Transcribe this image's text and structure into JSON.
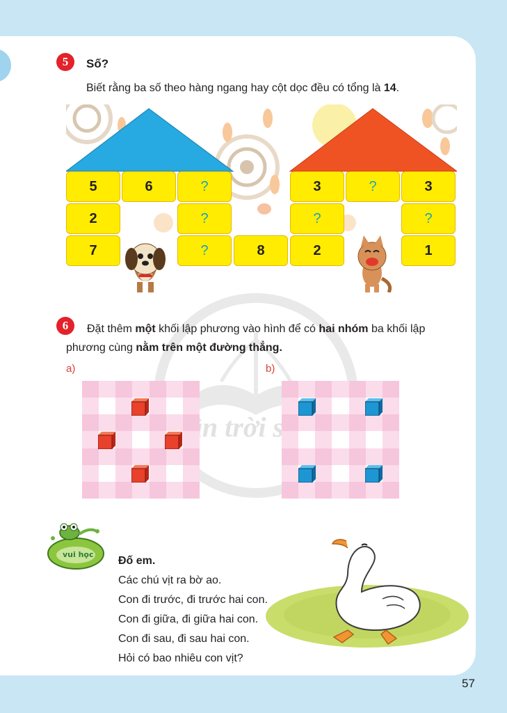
{
  "exercise5": {
    "number": "5",
    "title": "Số?",
    "instruction_prefix": "Biết rằng ba số theo hàng ngang hay cột dọc đều có tổng là ",
    "instruction_bold": "14",
    "instruction_suffix": ".",
    "left_house": {
      "roof_color": "#27a9e1",
      "cells": [
        [
          "5",
          "6",
          "?"
        ],
        [
          "2",
          "",
          "?"
        ],
        [
          "7",
          "",
          "?"
        ]
      ]
    },
    "middle_cell": "8",
    "right_house": {
      "roof_color": "#f05323",
      "cells": [
        [
          "3",
          "?",
          "3"
        ],
        [
          "?",
          "",
          "?"
        ],
        [
          "2",
          "",
          "1"
        ]
      ]
    }
  },
  "exercise6": {
    "number": "6",
    "text_1": "Đặt thêm ",
    "bold_1": "một",
    "text_2": " khối lập phương vào hình để có ",
    "bold_2": "hai nhóm",
    "text_3": " ba khối lập phương cùng ",
    "bold_3": "nằm trên một đường thẳng.",
    "label_a": "a)",
    "label_b": "b)",
    "cube_a_color": "#e8412c",
    "cube_b_color": "#1e96d4"
  },
  "riddle": {
    "badge": "vui học",
    "title": "Đố em.",
    "lines": [
      "Các chú vịt ra bờ ao.",
      "Con đi trước, đi trước hai con.",
      "Con đi giữa, đi giữa hai con.",
      "Con đi sau, đi sau hai con.",
      "Hỏi có bao nhiêu con vịt?"
    ]
  },
  "watermark": "Chân trời sáng tạo",
  "page_number": "57"
}
